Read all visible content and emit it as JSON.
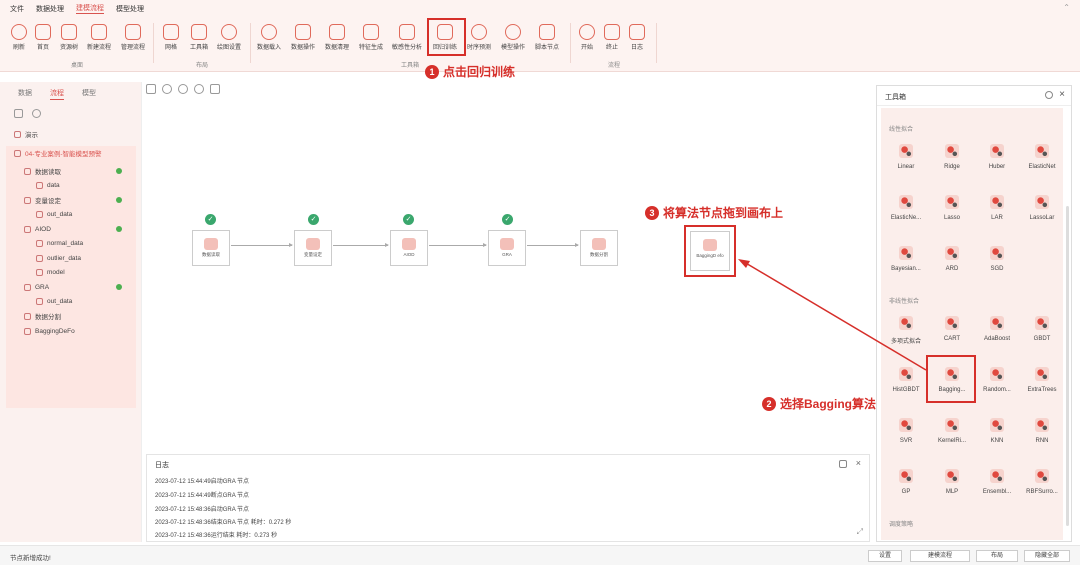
{
  "menubar": {
    "items": [
      "文件",
      "数据处理",
      "建模流程",
      "模型处理"
    ],
    "active_index": 2
  },
  "ribbon": {
    "groups": [
      {
        "label": "桌面",
        "buttons": [
          "刷新",
          "首页",
          "资源树",
          "新建流程",
          "管理流程"
        ]
      },
      {
        "label": "布局",
        "buttons": [
          "网格",
          "工具箱",
          "绘图设置"
        ]
      },
      {
        "label": "工具箱",
        "buttons": [
          "数据载入",
          "数据操作",
          "数据清理",
          "特征生成",
          "敏感性分析",
          "回归训练",
          "时序预测",
          "模型操作",
          "脚本节点"
        ]
      },
      {
        "label": "流程",
        "buttons": [
          "开始",
          "终止",
          "日志"
        ]
      }
    ]
  },
  "sidebar": {
    "tabs": [
      "数据",
      "流程",
      "模型"
    ],
    "active_tab": 1,
    "tree": [
      {
        "label": "演示",
        "level": 0
      },
      {
        "label": "04-专业案例-智能模型预警",
        "level": 0,
        "highlight": true
      },
      {
        "label": "数据读取",
        "level": 1,
        "status": true
      },
      {
        "label": "data",
        "level": 2
      },
      {
        "label": "变量设定",
        "level": 1,
        "status": true
      },
      {
        "label": "out_data",
        "level": 2
      },
      {
        "label": "AIOD",
        "level": 1,
        "status": true
      },
      {
        "label": "normal_data",
        "level": 2
      },
      {
        "label": "outlier_data",
        "level": 2
      },
      {
        "label": "model",
        "level": 2
      },
      {
        "label": "GRA",
        "level": 1,
        "status": true
      },
      {
        "label": "out_data",
        "level": 2
      },
      {
        "label": "数据分割",
        "level": 1
      },
      {
        "label": "BaggingDeFo",
        "level": 1
      }
    ]
  },
  "canvas": {
    "nodes": [
      {
        "label": "数据读取",
        "done": true
      },
      {
        "label": "变量设定",
        "done": true
      },
      {
        "label": "AIOD",
        "done": true
      },
      {
        "label": "GRA",
        "done": true
      },
      {
        "label": "数据分割",
        "done": false
      },
      {
        "label": "BaggingD efo",
        "done": false
      }
    ]
  },
  "log": {
    "title": "日志",
    "lines": [
      "2023-07-12 15:44:49启动GRA 节点",
      "2023-07-12 15:44:49断点GRA 节点",
      "2023-07-12 15:48:36启动GRA 节点",
      "2023-07-12 15:48:36结束GRA 节点 耗时：0.272 秒",
      "2023-07-12 15:48:36运行结束 耗时：0.273 秒"
    ]
  },
  "toolbox": {
    "title": "工具箱",
    "sections": [
      {
        "label": "线性拟合",
        "tools": [
          "Linear",
          "Ridge",
          "Huber",
          "ElasticNet",
          "ElasticNe...",
          "Lasso",
          "LAR",
          "LassoLar",
          "Bayesian...",
          "ARD",
          "SGD"
        ]
      },
      {
        "label": "非线性拟合",
        "tools": [
          "多项式拟合",
          "CART",
          "AdaBoost",
          "GBDT",
          "HistGBDT",
          "Bagging...",
          "Random...",
          "ExtraTrees",
          "SVR",
          "KernelRi...",
          "KNN",
          "RNN",
          "GP",
          "MLP",
          "Ensembl...",
          "RBFSurro..."
        ]
      },
      {
        "label": "调度策略",
        "tools": []
      }
    ]
  },
  "status": {
    "text": "节点新增成功!",
    "buttons": [
      "设置",
      "建模流程",
      "布局",
      "隐藏全部"
    ]
  },
  "annotations": [
    {
      "num": "1",
      "text": "点击回归训练"
    },
    {
      "num": "2",
      "text": "选择Bagging算法"
    },
    {
      "num": "3",
      "text": "将算法节点拖到画布上"
    }
  ],
  "colors": {
    "accent": "#d62f2a",
    "ribbon_bg": "#fdf3f1",
    "success": "#3aa76d"
  }
}
